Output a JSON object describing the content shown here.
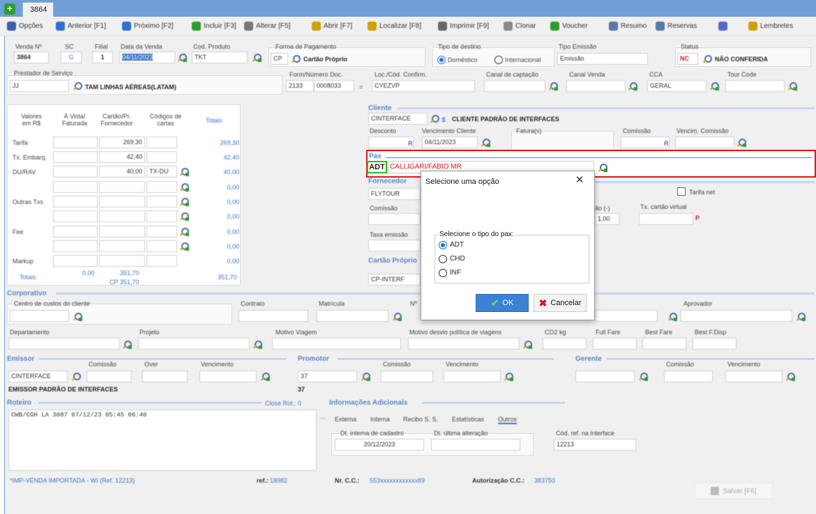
{
  "tab": {
    "label": "3864"
  },
  "toolbar": [
    {
      "label": "Opções",
      "color": "#3b5fa8"
    },
    {
      "label": "Anterior [F1]",
      "color": "#2f6fd0"
    },
    {
      "label": "Próximo [F2]",
      "color": "#2f6fd0"
    },
    {
      "label": "Incluir [F3]",
      "color": "#2e9c2e"
    },
    {
      "label": "Alterar [F5]",
      "color": "#777"
    },
    {
      "label": "Abrir [F7]",
      "color": "#d0a000"
    },
    {
      "label": "Localizar [F8]",
      "color": "#d0a000"
    },
    {
      "label": "Imprimir [F9]",
      "color": "#666"
    },
    {
      "label": "Clonar",
      "color": "#888"
    },
    {
      "label": "Voucher",
      "color": "#2e9c2e"
    },
    {
      "label": "Resumo",
      "color": "#5577aa"
    },
    {
      "label": "Reservas",
      "color": "#5577aa"
    },
    {
      "label": "",
      "color": "#5566cc"
    },
    {
      "label": "Lembretes",
      "color": "#d0a000"
    }
  ],
  "header": {
    "venda_label": "Venda Nº",
    "venda": "3864",
    "sc_label": "SC",
    "sc": "G",
    "filial_label": "Filial",
    "filial": "1",
    "data_label": "Data da Venda",
    "data": "04/11/2023",
    "produto_label": "Cod. Produto",
    "produto": "TKT",
    "pagamento_label": "Forma de Pagamento",
    "pagamento_code": "CP",
    "pagamento": "Cartão Próprio",
    "destino_label": "Tipo de destino",
    "dom": "Doméstico",
    "intl": "Internacional",
    "emissao_label": "Tipo Emissão",
    "emissao": "Emissão",
    "status_label": "Status",
    "status_code": "NC",
    "status": "NÃO CONFERIDA"
  },
  "row2": {
    "prestador_label": "Prestador de Serviço",
    "prestador_code": "JJ",
    "prestador": "TAM LINHAS AÉREAS(LATAM)",
    "form_label": "Form/Número Doc.",
    "form1": "2133",
    "form2": "0008033",
    "loc_label": "Loc./Cód. Confirm.",
    "loc": "CYEZVP",
    "canal_cap_label": "Canal de captação",
    "canal_venda_label": "Canal Venda",
    "cca_label": "CCA",
    "cca": "GERAL",
    "tour_label": "Tour Code"
  },
  "values": {
    "h1": "Valores em R$",
    "h2": "À Vista/ Faturada",
    "h3": "Cartão/Pr. Fornecedor",
    "h4": "Códigos de cartas",
    "h5": "Totais",
    "rows": [
      {
        "label": "Tarifa",
        "c2": "269,30",
        "total": "269,30"
      },
      {
        "label": "Tx. Embarq.",
        "c2": "42,40",
        "total": "42,40"
      },
      {
        "label": "DU/RAV",
        "c2": "40,00",
        "code": "TX-DU",
        "total": "40,00"
      },
      {
        "label": "",
        "total": "0,00"
      },
      {
        "label": "Outras Txs",
        "total": "0,00"
      },
      {
        "label": "",
        "total": "0,00"
      },
      {
        "label": "Fee",
        "total": "0,00"
      },
      {
        "label": "",
        "total": "0,00"
      },
      {
        "label": "Markup",
        "total": "0,00"
      }
    ],
    "tot_label": "Totais",
    "tot1": "0,00",
    "tot2": "351,70",
    "tot2b": "CP 351,70",
    "tot3": "351,70"
  },
  "cliente": {
    "section": "Cliente",
    "code": "CINTERFACE",
    "s": "S",
    "name": "CLIENTE PADRÃO DE INTERFACES",
    "desconto_label": "Desconto",
    "venc_label": "Vencimento Cliente",
    "venc": "04/11/2023",
    "fatura_label": "Fatura(s)",
    "comissao_label": "Comissão",
    "venc_com_label": "Vencim. Comissão"
  },
  "pax": {
    "section": "Pax",
    "type": "ADT",
    "name": "CALLIGARI/FABIO MR"
  },
  "fornecedor": {
    "section": "Fornecedor",
    "code": "FLYTOUR",
    "tarifa_net": "Tarifa net",
    "comissao_label": "Comissão",
    "taxa_label": "Taxa emissão",
    "tx_cartao_label": "Tx. cartão virtual",
    "cambio_value": "1,00",
    "cambio_label": "ão (-)"
  },
  "cartao": {
    "section": "Cartão Próprio",
    "value": "CP-INTERF"
  },
  "dialog": {
    "title": "Selecione uma opção",
    "group": "Selecione o tipo do pax:",
    "options": [
      "ADT",
      "CHD",
      "INF"
    ],
    "ok": "OK",
    "cancel": "Cancelar"
  },
  "corporativo": {
    "section": "Corporativo",
    "centro_label": "Centro de custos do cliente",
    "contrato_label": "Contrato",
    "matricula_label": "Matrícula",
    "nr_label": "Nº",
    "aprovador_label": "Aprovador",
    "depto_label": "Departamento",
    "projeto_label": "Projeto",
    "motivo_label": "Motivo Viagem",
    "desvio_label": "Motivo desvio política de viagens",
    "co2_label": "CO2 kg",
    "full_label": "Full Fare",
    "best_label": "Best Fare",
    "bestf_label": "Best F.Disp"
  },
  "emissor": {
    "section": "Emissor",
    "code": "CINTERFACE",
    "name": "EMISSOR PADRÃO DE INTERFACES",
    "com_label": "Comissão",
    "over_label": "Over",
    "venc_label": "Vencimento"
  },
  "promotor": {
    "section": "Promotor",
    "code": "37",
    "name": "37",
    "com_label": "Comissão",
    "venc_label": "Vencimento"
  },
  "gerente": {
    "section": "Gerente",
    "com_label": "Comissão",
    "venc_label": "Vencimento"
  },
  "roteiro": {
    "section": "Roteiro",
    "close": "Close Rot.: 0",
    "text": "CWB/CGH LA 3087 07/12/23 05:45 06:40"
  },
  "info": {
    "section": "Informações Adicionais",
    "tabs": [
      "Externa",
      "Interna",
      "Recibo S. S.",
      "Estatísticas",
      "Outros"
    ],
    "dt_label": "Dt. interna de cadastro",
    "dt": "20/12/2023",
    "alt_label": "Dt. última alteração",
    "ref_label": "Cód. ref. na interface",
    "ref": "12213"
  },
  "footer": {
    "note": "*IMP-VENDA IMPORTADA - WI (Ref. 12213)",
    "ref_label": "ref.:",
    "ref": "18982",
    "cc_label": "Nr. C.C.:",
    "cc": "553xxxxxxxxxxxx89",
    "auth_label": "Autorização C.C.:",
    "auth": "383750",
    "save": "Salvar [F6]"
  }
}
